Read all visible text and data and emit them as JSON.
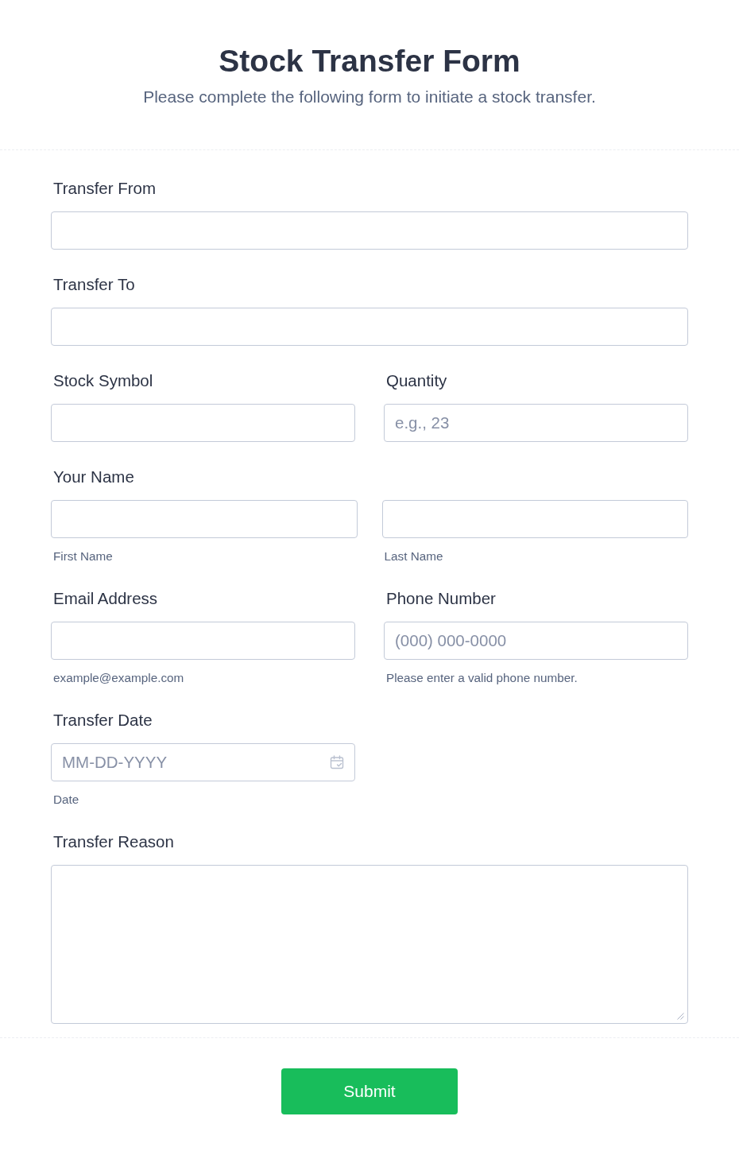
{
  "header": {
    "title": "Stock Transfer Form",
    "subtitle": "Please complete the following form to initiate a stock transfer."
  },
  "rows": [
    {
      "fields": [
        {
          "kind": "text",
          "label": "Transfer From"
        }
      ]
    },
    {
      "fields": [
        {
          "kind": "text",
          "label": "Transfer To"
        }
      ]
    },
    {
      "fields": [
        {
          "kind": "text",
          "label": "Stock Symbol"
        },
        {
          "kind": "text",
          "label": "Quantity",
          "placeholder": "e.g., 23"
        }
      ]
    },
    {
      "fields": [
        {
          "kind": "name",
          "label": "Your Name",
          "parts": [
            {
              "sublabel": "First Name"
            },
            {
              "sublabel": "Last Name"
            }
          ]
        }
      ]
    },
    {
      "fields": [
        {
          "kind": "text",
          "label": "Email Address",
          "sublabel": "example@example.com"
        },
        {
          "kind": "text",
          "label": "Phone Number",
          "placeholder": "(000) 000-0000",
          "sublabel": "Please enter a valid phone number."
        }
      ]
    },
    {
      "fields": [
        {
          "kind": "date",
          "label": "Transfer Date",
          "placeholder": "MM-DD-YYYY",
          "sublabel": "Date"
        }
      ]
    },
    {
      "fields": [
        {
          "kind": "textarea",
          "label": "Transfer Reason"
        }
      ]
    }
  ],
  "submit_button": {
    "label": "Submit"
  }
}
